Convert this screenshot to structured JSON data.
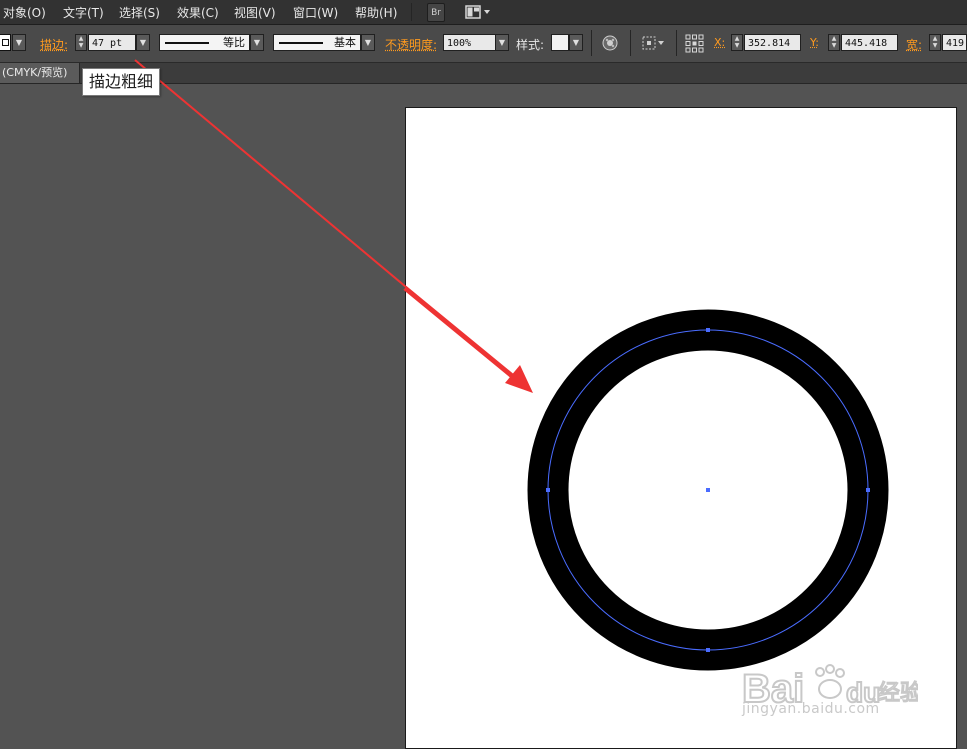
{
  "menu": {
    "items": [
      "对象(O)",
      "文字(T)",
      "选择(S)",
      "效果(C)",
      "视图(V)",
      "窗口(W)",
      "帮助(H)"
    ],
    "bridge_label": "Br"
  },
  "control_bar": {
    "stroke_label": "描边:",
    "stroke_weight": "47 pt",
    "profile_label": "等比",
    "brush_label": "基本",
    "opacity_label": "不透明度:",
    "opacity_value": "100%",
    "style_label": "样式:",
    "x_label": "X:",
    "x_value": "352.814",
    "y_label": "Y:",
    "y_value": "445.418",
    "w_label": "宽:",
    "w_value": "419"
  },
  "document": {
    "tab_title": "(CMYK/预览)"
  },
  "tooltip": {
    "text": "描边粗细"
  },
  "colors": {
    "accent_label": "#ff9a1e",
    "annotation_arrow": "#ee3333",
    "path_selection": "#4a6cff",
    "stroke": "#000000"
  },
  "icons": [
    "bridge-icon",
    "workspace-switcher-icon",
    "recolor-artwork-icon",
    "align-icon",
    "reference-point-icon"
  ],
  "watermark": {
    "brand_text": "Bai",
    "brand_text_2": "du",
    "cn_text": "经验",
    "site": "jingyan.baidu.com"
  }
}
